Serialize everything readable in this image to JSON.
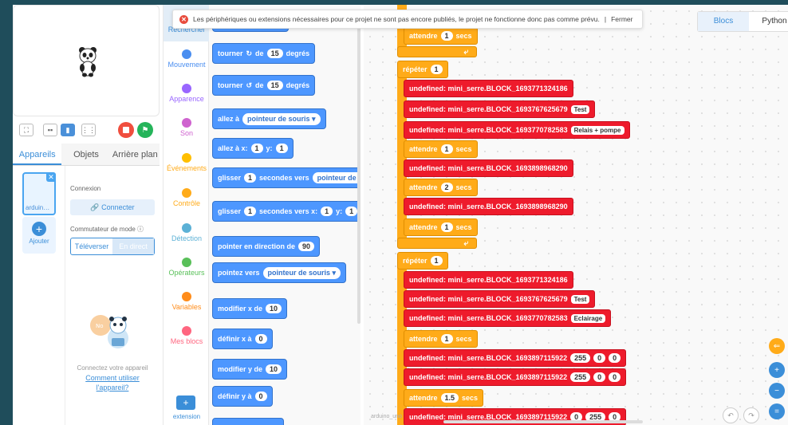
{
  "banner": {
    "message": "Les périphériques ou extensions nécessaires pour ce projet ne sont pas encore publiés, le projet ne fonctionne donc pas comme prévu.",
    "separator": "|",
    "close_label": "Fermer"
  },
  "stage": {
    "sprite": "panda-sprite"
  },
  "stage_toolbar": {
    "icons": [
      "fullscreen-icon",
      "small-stage-icon",
      "large-stage-icon",
      "grid-icon"
    ]
  },
  "device_tabs": [
    "Appareils",
    "Objets",
    "Arrière plan"
  ],
  "devices": {
    "device_name": "arduino_...",
    "add_label": "Ajouter",
    "connection_label": "Connexion",
    "connect_button": "Connecter",
    "mode_label": "Commutateur de mode ⓘ",
    "mode_upload": "Téléverser",
    "mode_live": "En direct",
    "help_text": "Connectez votre appareil",
    "help_link": "Comment utiliser l'appareil?"
  },
  "categories": [
    {
      "label": "Rechercher",
      "color": "#3b8ed8"
    },
    {
      "label": "Mouvement",
      "color": "#4a8ef0"
    },
    {
      "label": "Apparence",
      "color": "#9966ff"
    },
    {
      "label": "Son",
      "color": "#cf63cf"
    },
    {
      "label": "Événements",
      "color": "#ffbf00"
    },
    {
      "label": "Contrôle",
      "color": "#ffab19"
    },
    {
      "label": "Détection",
      "color": "#5cb1d6"
    },
    {
      "label": "Opérateurs",
      "color": "#59c059"
    },
    {
      "label": "Variables",
      "color": "#ff8c1a"
    },
    {
      "label": "Mes blocs",
      "color": "#ff6680"
    }
  ],
  "extension_label": "extension",
  "palette": {
    "turn_right": {
      "text": "tourner",
      "by": "de",
      "value": "15",
      "unit": "degrés"
    },
    "turn_left": {
      "text": "tourner",
      "by": "de",
      "value": "15",
      "unit": "degrés"
    },
    "goto": {
      "text": "allez à",
      "target": "pointeur de souris ▾"
    },
    "goto_xy": {
      "text": "allez à x:",
      "x": "1",
      "ylabel": "y:",
      "y": "1"
    },
    "glide_to": {
      "text": "glisser",
      "secs": "1",
      "mid": "secondes vers",
      "target": "pointeur de sou"
    },
    "glide_xy": {
      "text": "glisser",
      "secs": "1",
      "mid": "secondes vers x:",
      "x": "1",
      "ylabel": "y:",
      "y": "1"
    },
    "point_dir": {
      "text": "pointer en direction de",
      "value": "90"
    },
    "point_to": {
      "text": "pointez vers",
      "target": "pointeur de souris ▾"
    },
    "change_x": {
      "text": "modifier x de",
      "value": "10"
    },
    "set_x": {
      "text": "définir x à",
      "value": "0"
    },
    "change_y": {
      "text": "modifier y de",
      "value": "10"
    },
    "set_y": {
      "text": "définir y à",
      "value": "0"
    }
  },
  "lang_toggle": {
    "blocks": "Blocs",
    "python": "Python"
  },
  "workspace": {
    "label": "arduino_uno",
    "wait_word": "attendre",
    "secs_word": "secs",
    "repeat_word": "répéter",
    "blocks": [
      {
        "kind": "wait",
        "value": "1"
      },
      {
        "kind": "foot"
      },
      {
        "kind": "repeat",
        "value": "1"
      },
      {
        "kind": "call",
        "name": "undefined: mini_serre.BLOCK_1693771324186"
      },
      {
        "kind": "call",
        "name": "undefined: mini_serre.BLOCK_1693767625679",
        "args": [
          "Test"
        ]
      },
      {
        "kind": "call",
        "name": "undefined: mini_serre.BLOCK_1693770782583",
        "args": [
          "Relais + pompe"
        ]
      },
      {
        "kind": "wait",
        "value": "1"
      },
      {
        "kind": "call",
        "name": "undefined: mini_serre.BLOCK_1693898968290"
      },
      {
        "kind": "wait",
        "value": "2"
      },
      {
        "kind": "call",
        "name": "undefined: mini_serre.BLOCK_1693898968290"
      },
      {
        "kind": "wait",
        "value": "1"
      },
      {
        "kind": "foot"
      },
      {
        "kind": "repeat",
        "value": "1"
      },
      {
        "kind": "call",
        "name": "undefined: mini_serre.BLOCK_1693771324186"
      },
      {
        "kind": "call",
        "name": "undefined: mini_serre.BLOCK_1693767625679",
        "args": [
          "Test"
        ]
      },
      {
        "kind": "call",
        "name": "undefined: mini_serre.BLOCK_1693770782583",
        "args": [
          "Eclairage"
        ]
      },
      {
        "kind": "wait",
        "value": "1"
      },
      {
        "kind": "call",
        "name": "undefined: mini_serre.BLOCK_1693897115922",
        "nums": [
          "255",
          "0",
          "0"
        ]
      },
      {
        "kind": "call",
        "name": "undefined: mini_serre.BLOCK_1693897115922",
        "nums": [
          "255",
          "0",
          "0"
        ]
      },
      {
        "kind": "wait",
        "value": "1.5"
      },
      {
        "kind": "call",
        "name": "undefined: mini_serre.BLOCK_1693897115922",
        "nums": [
          "0",
          "255",
          "0"
        ]
      }
    ]
  },
  "right_controls": [
    "collapse-icon",
    "zoom-in-icon",
    "zoom-out-icon",
    "reset-zoom-icon"
  ],
  "undo_icons": [
    "undo-icon",
    "redo-icon"
  ]
}
